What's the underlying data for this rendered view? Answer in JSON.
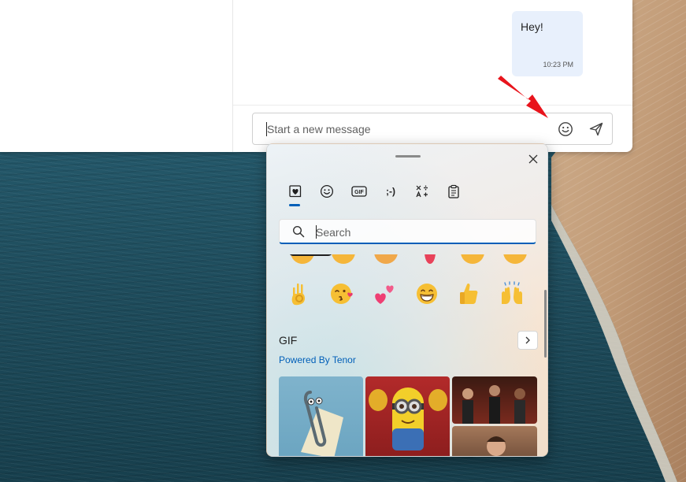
{
  "chat": {
    "messages": [
      {
        "text": "Hey!",
        "time": "10:23 PM"
      }
    ],
    "composer": {
      "placeholder": "Start a new message",
      "emoji_icon": "smiley-icon",
      "send_icon": "send-icon"
    },
    "annotation_color": "#e8141c"
  },
  "emoji_panel": {
    "tabs": [
      {
        "id": "favorites",
        "icon": "heart-favorites-icon",
        "selected": true
      },
      {
        "id": "emoji",
        "icon": "smiley-icon"
      },
      {
        "id": "gif",
        "icon": "gif-icon",
        "label": "GIF"
      },
      {
        "id": "kaomoji",
        "icon": "kaomoji-icon",
        "label": ";-)"
      },
      {
        "id": "symbols",
        "icon": "symbols-icon"
      },
      {
        "id": "clipboard",
        "icon": "clipboard-icon"
      }
    ],
    "search": {
      "placeholder": "Search"
    },
    "emoji_row": [
      "👌",
      "😘",
      "💕",
      "😁",
      "👍",
      "🙌"
    ],
    "gif_section": {
      "title": "GIF",
      "provider": "Powered By Tenor"
    },
    "accent_color": "#005fb8"
  }
}
